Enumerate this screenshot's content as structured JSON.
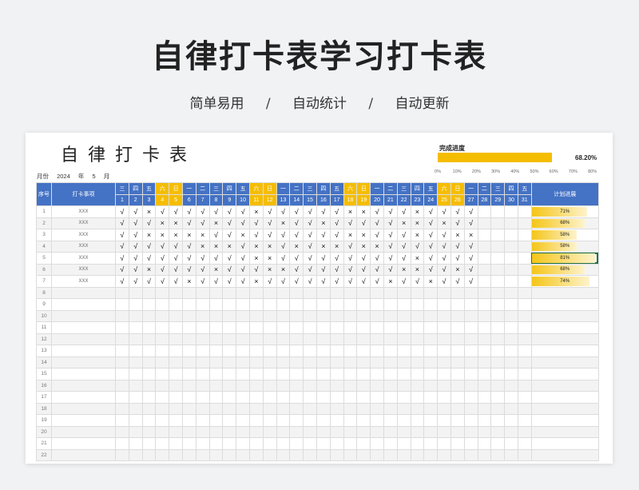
{
  "header": {
    "title": "自律打卡表学习打卡表",
    "taglines": [
      "简单易用",
      "自动统计",
      "自动更新"
    ],
    "separator": "/"
  },
  "sheet": {
    "title": "自律打卡表",
    "month_label": "月份",
    "year": "2024",
    "year_unit": "年",
    "month": "5",
    "month_unit": "月",
    "progress_title": "完成进度",
    "progress_value": "68.20%",
    "progress_fraction": 0.682,
    "progress_axis": [
      "0%",
      "10%",
      "20%",
      "30%",
      "40%",
      "50%",
      "60%",
      "70%",
      "80%"
    ],
    "col_seq": "序号",
    "col_item": "打卡事项",
    "col_progress": "计划进展",
    "weekdays": [
      "三",
      "四",
      "五",
      "六",
      "日",
      "一",
      "二",
      "三",
      "四",
      "五",
      "六",
      "日",
      "一",
      "二",
      "三",
      "四",
      "五",
      "六",
      "日",
      "一",
      "二",
      "三",
      "四",
      "五",
      "六",
      "日",
      "一",
      "二",
      "三",
      "四",
      "五"
    ],
    "days": [
      "1",
      "2",
      "3",
      "4",
      "5",
      "6",
      "7",
      "8",
      "9",
      "10",
      "11",
      "12",
      "13",
      "14",
      "15",
      "16",
      "17",
      "18",
      "19",
      "20",
      "21",
      "22",
      "23",
      "24",
      "25",
      "26",
      "27",
      "28",
      "29",
      "30",
      "31"
    ],
    "rows": [
      {
        "seq": "1",
        "item": "XXX",
        "marks": "√√×√√√√√√√×√√√√√√××√√√×√√√√",
        "progress": "71%",
        "fraction": 0.71
      },
      {
        "seq": "2",
        "item": "XXX",
        "marks": "√√√××√√×√√√√×√√×√√√√√××√×√√",
        "progress": "68%",
        "fraction": 0.68
      },
      {
        "seq": "3",
        "item": "XXX",
        "marks": "√√×××××√√×√√√√√√√××√√√×√√××",
        "progress": "58%",
        "fraction": 0.58
      },
      {
        "seq": "4",
        "item": "XXX",
        "marks": "√√√√√√×××√××√×√××√××√√√√√√√",
        "progress": "58%",
        "fraction": 0.58
      },
      {
        "seq": "5",
        "item": "XXX",
        "marks": "√√√√√√√√√√××√√√√√√√√√√×√√√√",
        "progress": "81%",
        "fraction": 0.81
      },
      {
        "seq": "6",
        "item": "XXX",
        "marks": "√√×√√√√×√√√××√√√√√√√√××√√×√",
        "progress": "68%",
        "fraction": 0.68
      },
      {
        "seq": "7",
        "item": "XXX",
        "marks": "√√√√√×√√√√×√√√√√√√√√×√√×√√√",
        "progress": "74%",
        "fraction": 0.74
      },
      {
        "seq": "8"
      },
      {
        "seq": "9"
      },
      {
        "seq": "10"
      },
      {
        "seq": "11"
      },
      {
        "seq": "12"
      },
      {
        "seq": "13"
      },
      {
        "seq": "14"
      },
      {
        "seq": "15"
      },
      {
        "seq": "16"
      },
      {
        "seq": "17"
      },
      {
        "seq": "18"
      },
      {
        "seq": "19"
      },
      {
        "seq": "20"
      },
      {
        "seq": "21"
      },
      {
        "seq": "22"
      }
    ]
  },
  "colors": {
    "header_blue": "#4472c4",
    "weekend_yellow": "#f5bd00",
    "selection_green": "#217346"
  }
}
